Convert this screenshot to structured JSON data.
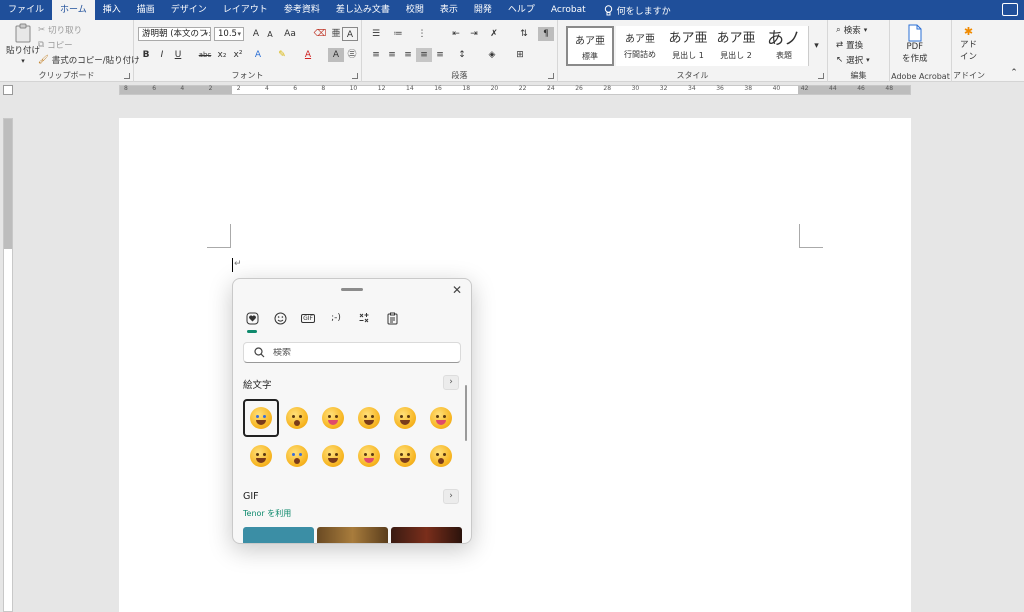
{
  "menu": {
    "tabs": [
      {
        "label": "ファイル",
        "active": false
      },
      {
        "label": "ホーム",
        "active": true
      },
      {
        "label": "挿入",
        "active": false
      },
      {
        "label": "描画",
        "active": false
      },
      {
        "label": "デザイン",
        "active": false
      },
      {
        "label": "レイアウト",
        "active": false
      },
      {
        "label": "参考資料",
        "active": false
      },
      {
        "label": "差し込み文書",
        "active": false
      },
      {
        "label": "校閲",
        "active": false
      },
      {
        "label": "表示",
        "active": false
      },
      {
        "label": "開発",
        "active": false
      },
      {
        "label": "ヘルプ",
        "active": false
      },
      {
        "label": "Acrobat",
        "active": false
      }
    ],
    "tell_me": "何をしますか",
    "accent": "#1f4f9a"
  },
  "ribbon": {
    "clipboard": {
      "paste": "貼り付け",
      "cut": "切り取り",
      "copy": "コピー",
      "format_painter": "書式のコピー/貼り付け",
      "label": "クリップボード"
    },
    "font": {
      "family": "游明朝 (本文のフォ",
      "size": "10.5",
      "grow": "A",
      "shrink": "A",
      "case": "Aa",
      "bold": "B",
      "italic": "I",
      "underline": "U",
      "strike": "abc",
      "subscript": "x₂",
      "superscript": "x²",
      "label": "フォント"
    },
    "paragraph": {
      "label": "段落"
    },
    "styles": {
      "items": [
        {
          "preview": "あア亜",
          "name": "標準",
          "selected": true
        },
        {
          "preview": "あア亜",
          "name": "行間詰め",
          "selected": false
        },
        {
          "preview": "あア亜",
          "name": "見出し 1",
          "selected": false
        },
        {
          "preview": "あア亜",
          "name": "見出し 2",
          "selected": false
        },
        {
          "preview": "あノ",
          "name": "表題",
          "selected": false
        }
      ],
      "label": "スタイル"
    },
    "editing": {
      "find": "検索",
      "replace": "置換",
      "select": "選択",
      "label": "編集"
    },
    "acrobat": {
      "create_pdf_line1": "PDF",
      "create_pdf_line2": "を作成",
      "label": "Adobe Acrobat"
    },
    "addins": {
      "btn_line1": "アド",
      "btn_line2": "イン",
      "label": "アドイン"
    }
  },
  "ruler": {
    "numbers": [
      "8",
      "6",
      "4",
      "2",
      "2",
      "4",
      "6",
      "8",
      "10",
      "12",
      "14",
      "16",
      "18",
      "20",
      "22",
      "24",
      "26",
      "28",
      "30",
      "32",
      "34",
      "36",
      "38",
      "40",
      "42",
      "44",
      "46",
      "48"
    ]
  },
  "document": {
    "paragraph_mark": "↵"
  },
  "emoji_panel": {
    "tabs": [
      {
        "icon": "heart-emoji-icon",
        "active": true
      },
      {
        "icon": "smiley-icon",
        "active": false
      },
      {
        "icon": "gif-icon",
        "active": false
      },
      {
        "icon": "kaomoji-icon",
        "active": false
      },
      {
        "icon": "symbols-icon",
        "active": false
      },
      {
        "icon": "clipboard-icon",
        "active": false
      }
    ],
    "gif_tab_label": "GIF",
    "kaomoji_tab_label": ";-)",
    "search_placeholder": "検索",
    "emoji_section_title": "絵文字",
    "gif_section_title": "GIF",
    "tenor_label": "Tenor を利用",
    "more_label": "›",
    "close_label": "✕",
    "accent": "#0f8a6d"
  }
}
